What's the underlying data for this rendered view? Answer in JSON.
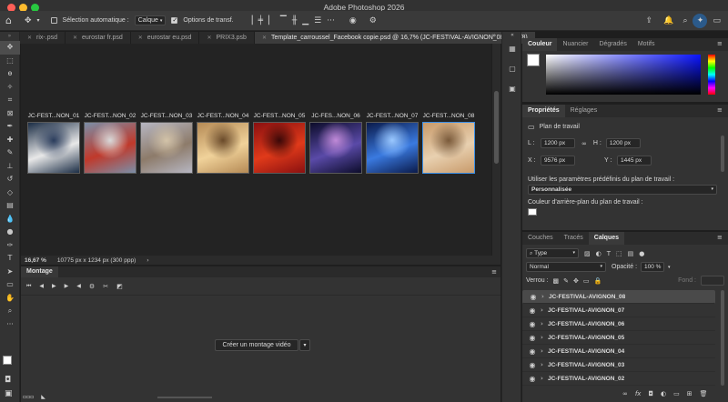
{
  "app": {
    "title": "Adobe Photoshop 2026"
  },
  "options": {
    "auto_select_label": "Sélection automatique :",
    "auto_select_value": "Calque",
    "transform_label": "Options de transf."
  },
  "tabs": [
    {
      "label": "rix-.psd",
      "active": false
    },
    {
      "label": "eurostar fr.psd",
      "active": false
    },
    {
      "label": "eurostar eu.psd",
      "active": false
    },
    {
      "label": "PRIX3.psb",
      "active": false
    },
    {
      "label": "Template_carroussel_Facebook copie.psd @ 16,7% (JC-FESTIVAL-AVIGNON_08, RVB/8)",
      "active": true
    }
  ],
  "artboards": [
    {
      "label": "JC-FEST...NON_01",
      "colors": [
        "#1b2d45",
        "#e8e8e8",
        "#2a3c5c"
      ]
    },
    {
      "label": "JC-FEST...NON_02",
      "colors": [
        "#7a8fa8",
        "#c0392b",
        "#d9d9d9"
      ]
    },
    {
      "label": "JC-FEST...NON_03",
      "colors": [
        "#b6b6c2",
        "#8d7b6a",
        "#d3c3a8"
      ]
    },
    {
      "label": "JC-FEST...NON_04",
      "colors": [
        "#b58a55",
        "#f0d29a",
        "#6a4a2a"
      ]
    },
    {
      "label": "JC-FEST...NON_05",
      "colors": [
        "#8a1010",
        "#e03a1a",
        "#3a0808"
      ]
    },
    {
      "label": "JC-FES...NON_06",
      "colors": [
        "#0c0c2a",
        "#5a4aa8",
        "#c08ad8"
      ]
    },
    {
      "label": "JC-FEST...NON_07",
      "colors": [
        "#0a1a4a",
        "#3a7ae0",
        "#9ac8ff"
      ]
    },
    {
      "label": "JC-FEST...NON_08",
      "colors": [
        "#c89a6a",
        "#e8d0b0",
        "#7a5a3a"
      ],
      "selected": true
    }
  ],
  "status": {
    "zoom": "16,67 %",
    "doc_info": "10775 px x 1234 px (300 ppp)"
  },
  "timeline": {
    "title": "Montage",
    "create_button": "Créer un montage vidéo"
  },
  "color_panel": {
    "tabs": [
      "Couleur",
      "Nuancier",
      "Dégradés",
      "Motifs"
    ],
    "active": "Couleur",
    "hue_color": "#0a14ff"
  },
  "properties": {
    "tabs": [
      "Propriétés",
      "Réglages"
    ],
    "type_label": "Plan de travail",
    "L_label": "L :",
    "L_value": "1200 px",
    "H_label": "H :",
    "H_value": "1200 px",
    "X_label": "X :",
    "X_value": "9576 px",
    "Y_label": "Y :",
    "Y_value": "1445 px",
    "preset_label": "Utiliser les paramètres prédéfinis du plan de travail :",
    "preset_value": "Personnalisée",
    "bg_label": "Couleur d'arrière-plan du plan de travail :"
  },
  "layers": {
    "tabs": [
      "Couches",
      "Tracés",
      "Calques"
    ],
    "active": "Calques",
    "filter": "Type",
    "blend": "Normal",
    "opacity_label": "Opacité :",
    "opacity_value": "100 %",
    "lock_label": "Verrou :",
    "fill_label": "Fond :",
    "items": [
      {
        "name": "JC-FESTIVAL-AVIGNON_08",
        "selected": true
      },
      {
        "name": "JC-FESTIVAL-AVIGNON_07"
      },
      {
        "name": "JC-FESTIVAL-AVIGNON_06"
      },
      {
        "name": "JC-FESTIVAL-AVIGNON_05"
      },
      {
        "name": "JC-FESTIVAL-AVIGNON_04"
      },
      {
        "name": "JC-FESTIVAL-AVIGNON_03"
      },
      {
        "name": "JC-FESTIVAL-AVIGNON_02"
      }
    ]
  },
  "tools": [
    "move-icon",
    "marquee-icon",
    "lasso-icon",
    "quick-select-icon",
    "crop-icon",
    "frame-icon",
    "eyedropper-icon",
    "healing-icon",
    "brush-icon",
    "stamp-icon",
    "history-brush-icon",
    "eraser-icon",
    "gradient-icon",
    "blur-icon",
    "dodge-icon",
    "pen-icon",
    "type-icon",
    "path-select-icon",
    "shape-icon",
    "hand-icon",
    "zoom-icon",
    "more-icon"
  ]
}
